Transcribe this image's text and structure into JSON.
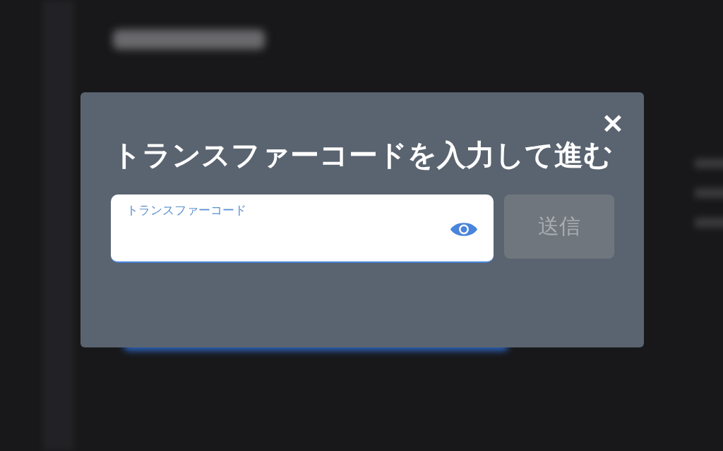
{
  "dialog": {
    "title": "トランスファーコードを入力して進む",
    "close": "✕",
    "field": {
      "placeholder": "トランスファーコード"
    },
    "submit": {
      "label": "送信",
      "disabled": true
    }
  }
}
